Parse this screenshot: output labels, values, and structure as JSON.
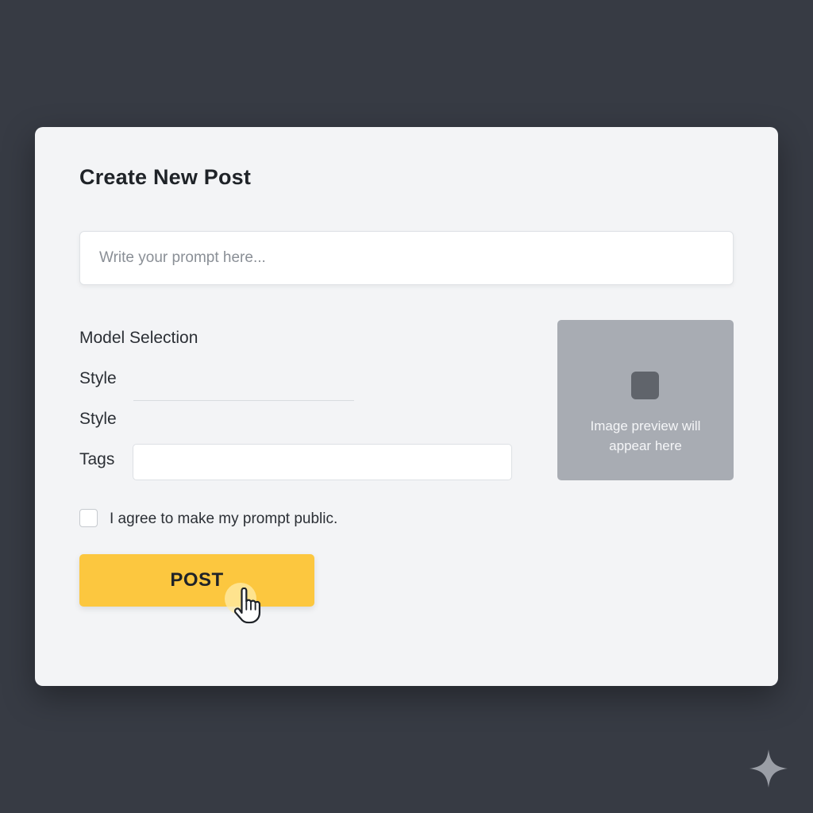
{
  "form": {
    "title": "Create New Post",
    "prompt_placeholder": "Write your prompt here...",
    "prompt_value": "",
    "model_selection_label": "Model Selection",
    "style_label_1": "Style",
    "style_label_2": "Style",
    "tags_label": "Tags",
    "tags_value": "",
    "checkbox_label": "I agree to make my prompt public.",
    "checkbox_checked": false,
    "post_button_label": "POST"
  },
  "preview": {
    "text": "Image preview will appear here",
    "icon": "image-placeholder-icon"
  },
  "icons": {
    "cursor": "hand-pointer-icon",
    "watermark": "sparkle-icon"
  },
  "colors": {
    "background": "#373b44",
    "card": "#f3f4f6",
    "accent": "#fcc73f",
    "preview_panel": "#a8acb3"
  }
}
